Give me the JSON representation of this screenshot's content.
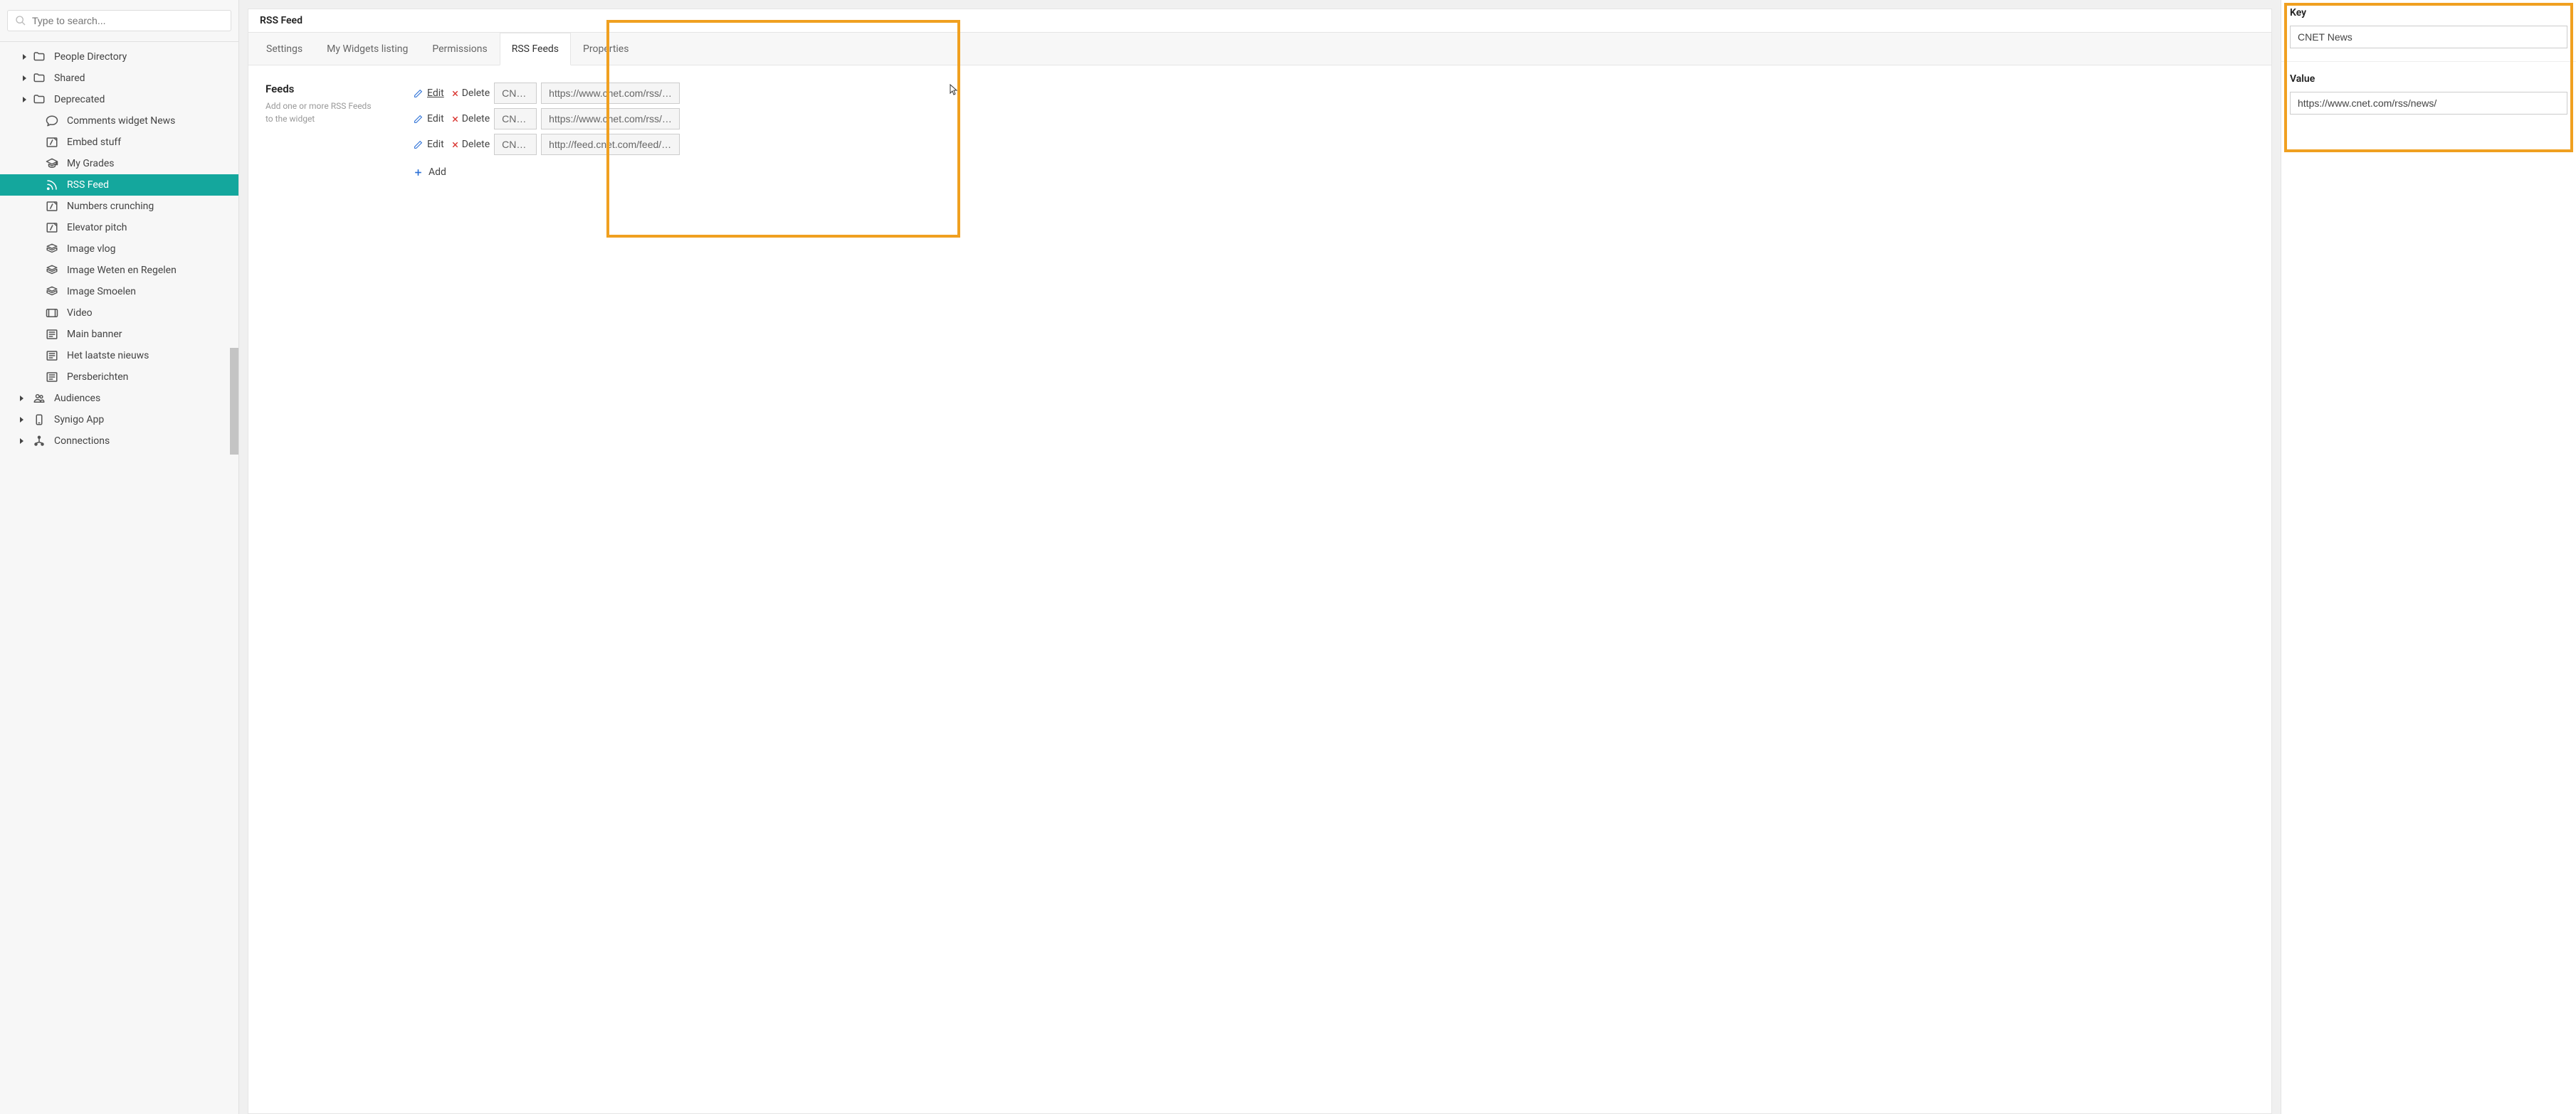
{
  "search": {
    "placeholder": "Type to search..."
  },
  "sidebar": {
    "items": [
      {
        "label": "People Directory",
        "icon": "folder",
        "caret": true,
        "level": 1
      },
      {
        "label": "Shared",
        "icon": "folder",
        "caret": true,
        "level": 1
      },
      {
        "label": "Deprecated",
        "icon": "folder",
        "caret": true,
        "level": 1
      },
      {
        "label": "Comments widget News",
        "icon": "comment",
        "caret": false,
        "level": 2
      },
      {
        "label": "Embed stuff",
        "icon": "embed",
        "caret": false,
        "level": 2
      },
      {
        "label": "My Grades",
        "icon": "grad",
        "caret": false,
        "level": 2
      },
      {
        "label": "RSS Feed",
        "icon": "rss",
        "caret": false,
        "level": 2,
        "active": true
      },
      {
        "label": "Numbers crunching",
        "icon": "embed",
        "caret": false,
        "level": 2
      },
      {
        "label": "Elevator pitch",
        "icon": "embed",
        "caret": false,
        "level": 2
      },
      {
        "label": "Image vlog",
        "icon": "image",
        "caret": false,
        "level": 2
      },
      {
        "label": "Image Weten en Regelen",
        "icon": "image",
        "caret": false,
        "level": 2
      },
      {
        "label": "Image Smoelen",
        "icon": "image",
        "caret": false,
        "level": 2
      },
      {
        "label": "Video",
        "icon": "video",
        "caret": false,
        "level": 2
      },
      {
        "label": "Main banner",
        "icon": "news",
        "caret": false,
        "level": 2
      },
      {
        "label": "Het laatste nieuws",
        "icon": "news",
        "caret": false,
        "level": 2
      },
      {
        "label": "Persberichten",
        "icon": "news",
        "caret": false,
        "level": 2
      },
      {
        "label": "Audiences",
        "icon": "audience",
        "caret": true,
        "level": 0
      },
      {
        "label": "Synigo App",
        "icon": "mobile",
        "caret": true,
        "level": 0
      },
      {
        "label": "Connections",
        "icon": "connection",
        "caret": true,
        "level": 0
      }
    ]
  },
  "header": {
    "title": "RSS Feed"
  },
  "tabs": [
    {
      "label": "Settings",
      "active": false
    },
    {
      "label": "My Widgets listing",
      "active": false
    },
    {
      "label": "Permissions",
      "active": false
    },
    {
      "label": "RSS Feeds",
      "active": true
    },
    {
      "label": "Properties",
      "active": false
    }
  ],
  "feeds_section": {
    "title": "Feeds",
    "description": "Add one or more RSS Feeds to the widget",
    "edit_label": "Edit",
    "delete_label": "Delete",
    "add_label": "Add",
    "rows": [
      {
        "key": "CNET News",
        "url": "https://www.cnet.com/rss/news/",
        "edit_underline": true
      },
      {
        "key": "CNET Gaming",
        "url": "https://www.cnet.com/rss/gaming/",
        "edit_underline": false
      },
      {
        "key": "CNET Video",
        "url": "http://feed.cnet.com/feed/podcast",
        "edit_underline": false
      }
    ]
  },
  "right_panel": {
    "key_label": "Key",
    "key_value": "CNET News",
    "value_label": "Value",
    "value_value": "https://www.cnet.com/rss/news/"
  }
}
